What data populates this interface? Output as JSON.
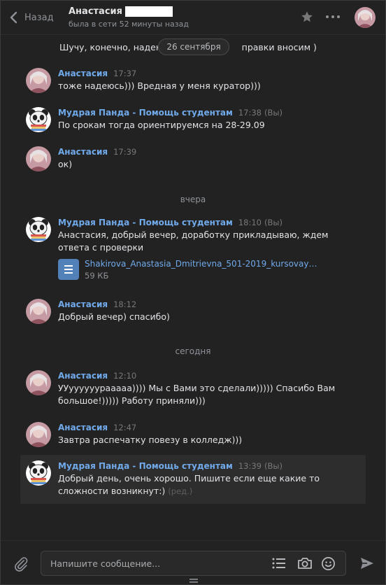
{
  "header": {
    "back_label": "Назад",
    "contact_name": "Анастасия",
    "status": "была в сети 52 минуты назад"
  },
  "feed": {
    "date_pill": "26 сентября",
    "partial_message": "Шучу, конечно, надеюсь… правки вносим )",
    "partial_left": "Шучу, конечно, надеюсь",
    "partial_right": "правки вносим )",
    "divider_yesterday": "вчера",
    "divider_today": "сегодня"
  },
  "messages": [
    {
      "author": "Анастасия",
      "time": "17:37",
      "you": "",
      "lines": [
        "тоже надеюсь))) Вредная у меня куратор)))"
      ]
    },
    {
      "author": "Мудрая Панда - Помощь студентам",
      "time": "17:38",
      "you": "(Вы)",
      "lines": [
        "По срокам тогда ориентируемся на 28-29.09"
      ]
    },
    {
      "author": "Анастасия",
      "time": "17:39",
      "you": "",
      "lines": [
        "ок)"
      ]
    },
    {
      "author": "Мудрая Панда - Помощь студентам",
      "time": "18:10",
      "you": "(Вы)",
      "lines": [
        "Анастасия, добрый вечер, доработку прикладываю, ждем",
        "ответа с проверки"
      ],
      "file": {
        "name": "Shakirova_Anastasia_Dmitrievna_501-2019_kursovay…",
        "size": "59 КБ"
      }
    },
    {
      "author": "Анастасия",
      "time": "18:12",
      "you": "",
      "lines": [
        "Добрый вечер) спасибо)"
      ]
    },
    {
      "author": "Анастасия",
      "time": "12:10",
      "you": "",
      "lines": [
        "УУуууууураааaa)))) Мы с Вами это сделали))))) Спасибо Вам",
        "большое!))))) Работу приняли)))"
      ]
    },
    {
      "author": "Анастасия",
      "time": "12:47",
      "you": "",
      "lines": [
        "Завтра распечатку повезу в колледж)))"
      ]
    },
    {
      "author": "Мудрая Панда - Помощь студентам",
      "time": "13:39",
      "you": "(Вы)",
      "lines": [
        "Добрый день, очень хорошо. Пишите если еще какие то",
        "сложности возникнут:)"
      ],
      "edited": "(ред.)"
    }
  ],
  "composer": {
    "placeholder": "Напишите сообщение..."
  },
  "colors": {
    "background": "#222222",
    "author_link": "#71aaeb",
    "selected_row": "#2d2d2d",
    "file_icon": "#5181b8"
  },
  "icons": [
    "chevron-left-icon",
    "star-icon",
    "more-icon",
    "attach-icon",
    "commands-icon",
    "camera-icon",
    "smile-icon",
    "send-icon",
    "document-icon",
    "resize-grip-icon"
  ]
}
